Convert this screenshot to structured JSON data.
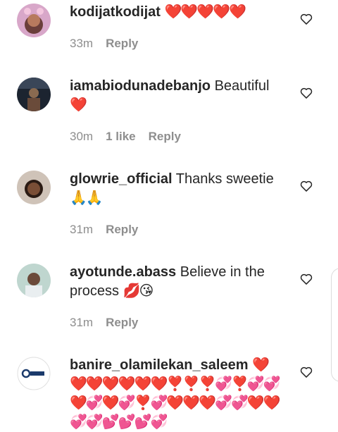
{
  "comments": [
    {
      "username": "kodijatkodijat",
      "text": "",
      "emoji": "❤️❤️❤️❤️❤️",
      "time": "33m",
      "likes": "",
      "reply": "Reply"
    },
    {
      "username": "iamabiodunadebanjo",
      "text": "Beautiful",
      "emoji": "❤️",
      "time": "30m",
      "likes": "1 like",
      "reply": "Reply"
    },
    {
      "username": "glowrie_official",
      "text": "Thanks sweetie",
      "emoji": "🙏🙏",
      "time": "31m",
      "likes": "",
      "reply": "Reply"
    },
    {
      "username": "ayotunde.abass",
      "text": "Believe in the process",
      "emoji": "💋😘",
      "time": "31m",
      "likes": "",
      "reply": "Reply"
    },
    {
      "username": "banire_olamilekan_saleem",
      "text": "",
      "emoji": "❤️❤️❤️❤️❤️❤️❤️❣️❣️❣️💞❣️💞💞❤️💞❤️💞❣️💞❤️❤️❤️💞💞❤️❤️💞💞💕💕💕💞",
      "time": "",
      "likes": "",
      "reply": ""
    }
  ],
  "icons": {
    "like": "heart-outline-icon"
  },
  "colors": {
    "meta": "#8e8e8e",
    "text": "#262626"
  }
}
